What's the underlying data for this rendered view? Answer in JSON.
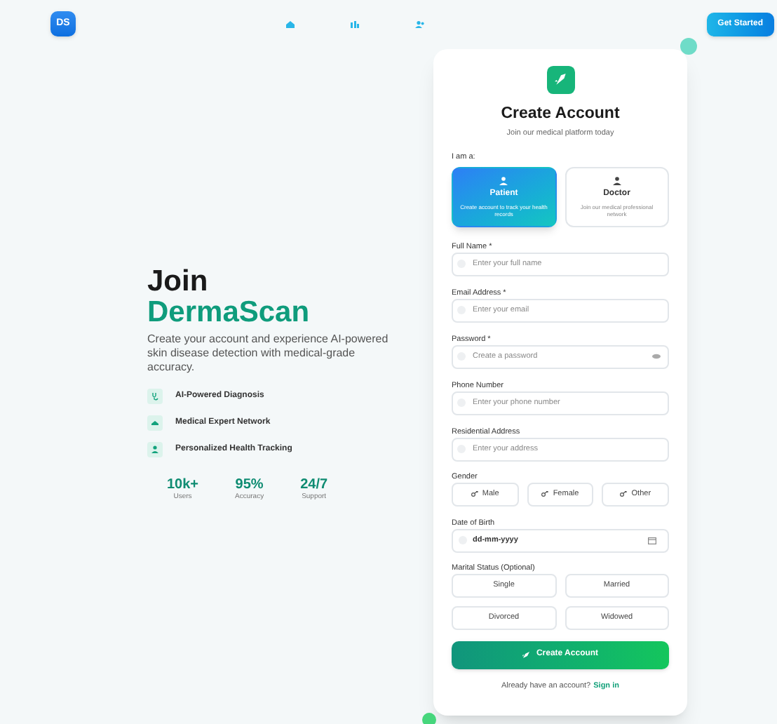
{
  "nav": {
    "logo": "DS",
    "cta": "Get Started"
  },
  "hero": {
    "title_line1": "Join",
    "title_line2": "DermaScan",
    "description": "Create your account and experience AI-powered skin disease detection with medical-grade accuracy.",
    "features": [
      {
        "kind": "stethoscope",
        "label": "AI-Powered Diagnosis"
      },
      {
        "kind": "network",
        "label": "Medical Expert Network"
      },
      {
        "kind": "user",
        "label": "Personalized Health Tracking"
      }
    ],
    "stats": [
      {
        "value": "10k+",
        "label": "Users"
      },
      {
        "value": "95%",
        "label": "Accuracy"
      },
      {
        "value": "24/7",
        "label": "Support"
      }
    ]
  },
  "form": {
    "title": "Create Account",
    "subtitle": "Join our medical platform today",
    "role_label": "I am a:",
    "roles": [
      {
        "title": "Patient",
        "description": "Create account to track your health records",
        "selected": true
      },
      {
        "title": "Doctor",
        "description": "Join our medical professional network",
        "selected": false
      }
    ],
    "fields": [
      {
        "label": "Full Name *",
        "placeholder": "Enter your full name",
        "kind": "text"
      },
      {
        "label": "Email Address *",
        "placeholder": "Enter your email",
        "kind": "text"
      },
      {
        "label": "Password *",
        "placeholder": "Create a password",
        "kind": "password"
      },
      {
        "label": "Phone Number",
        "placeholder": "Enter your phone number",
        "kind": "text"
      },
      {
        "label": "Residential Address",
        "placeholder": "Enter your address",
        "kind": "text"
      }
    ],
    "gender_label": "Gender",
    "genders": [
      {
        "label": "Male",
        "selected": false
      },
      {
        "label": "Female",
        "selected": false
      },
      {
        "label": "Other",
        "selected": false
      }
    ],
    "dob_label": "Date of Birth",
    "dob_value": "dd-mm-yyyy",
    "marital_label": "Marital Status (Optional)",
    "marital": [
      {
        "label": "Single",
        "selected": false
      },
      {
        "label": "Married",
        "selected": false
      },
      {
        "label": "Divorced",
        "selected": false
      },
      {
        "label": "Widowed",
        "selected": false
      }
    ],
    "submit": "Create Account",
    "signin_text": "Already have an account?",
    "signin_link": "Sign in"
  }
}
